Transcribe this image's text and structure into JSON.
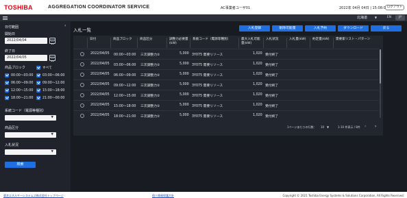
{
  "header": {
    "logo": "TOSHIBA",
    "app_title": "AGGREGATION COORDINATOR SERVICE",
    "user_name": "AC事業者ユーザ01",
    "datetime": "2022年 04月 04日 | 15:08:03",
    "logout_label": "ログアウト",
    "region": "北海道",
    "lang_en": "EN",
    "lang_ja": "JP",
    "brand_color": "#e60012",
    "accent_color": "#1f6fe0"
  },
  "sidebar": {
    "date_range_label": "日付範囲",
    "start_label": "開始日",
    "start_value": "2022/04/04",
    "end_label": "終了日",
    "end_value": "2022/04/05",
    "block_label": "商品ブロック",
    "all_label": "すべて",
    "blocks": [
      "00:00～03:00",
      "03:00～06:00",
      "06:00～09:00",
      "09:00～12:00",
      "12:00～15:00",
      "15:00～18:00",
      "18:00～21:00",
      "21:00～00:00"
    ],
    "system_code_label": "系統コード（電源等種別）",
    "product_class_label": "商品区分",
    "bid_status_label": "入札状況",
    "search_label": "検索"
  },
  "main": {
    "title": "入札一覧",
    "actions": [
      "入札登録",
      "削除可能量",
      "入札予約",
      "ダウンロード",
      "戻る"
    ],
    "columns": [
      "日付",
      "商品ブロック",
      "商品区分",
      "調整力必要量(kW)",
      "系統コード（電源等種別）",
      "最大入札可能量(kW)",
      "入札状況",
      "入札量(kW)",
      "約定量(kW)",
      "需要家リスト・パターン"
    ],
    "rows": [
      {
        "date": "2022/04/05",
        "block": "00:00～03:00",
        "class": "三次調整力②",
        "required": "5,000",
        "code": "3Y075 需要リソース",
        "max": "1,020",
        "status": "受付終了"
      },
      {
        "date": "2022/04/05",
        "block": "03:00～06:00",
        "class": "三次調整力②",
        "required": "5,000",
        "code": "3Y075 需要リソース",
        "max": "1,020",
        "status": "受付終了"
      },
      {
        "date": "2022/04/05",
        "block": "06:00～09:00",
        "class": "三次調整力②",
        "required": "5,000",
        "code": "3Y075 需要リソース",
        "max": "1,020",
        "status": "受付終了"
      },
      {
        "date": "2022/04/05",
        "block": "09:00～12:00",
        "class": "三次調整力②",
        "required": "5,000",
        "code": "3Y075 需要リソース",
        "max": "1,020",
        "status": "受付終了"
      },
      {
        "date": "2022/04/05",
        "block": "12:00～15:00",
        "class": "三次調整力②",
        "required": "5,000",
        "code": "3Y075 需要リソース",
        "max": "1,020",
        "status": "受付終了"
      },
      {
        "date": "2022/04/05",
        "block": "15:00～18:00",
        "class": "三次調整力②",
        "required": "5,000",
        "code": "3Y075 需要リソース",
        "max": "1,020",
        "status": "受付終了"
      },
      {
        "date": "2022/04/05",
        "block": "18:00～21:00",
        "class": "三次調整力②",
        "required": "5,000",
        "code": "3Y075 需要リソース",
        "max": "1,020",
        "status": "受付終了"
      }
    ],
    "pager_rows_label": "1ページあたりの行数：",
    "pager_rows_value": "10",
    "pager_range": "1-10 件表示 / 8件"
  },
  "footer": {
    "link1": "東芝エネルギーシステムズ株式会社トップページ",
    "link2": "個人情報保護方針",
    "copyright": "Copyright © 2021 Toshiba Energy Systems & Solutions Corporation, All Rights Reserved."
  }
}
